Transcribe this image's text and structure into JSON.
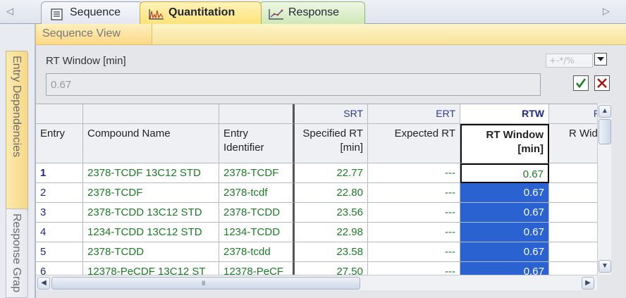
{
  "nav": {
    "scroll_left": "◁",
    "scroll_right": "▷"
  },
  "tabs": [
    {
      "label": "Sequence",
      "icon": "document-list-icon"
    },
    {
      "label": "Quantitation",
      "icon": "chromatogram-icon",
      "active": true
    },
    {
      "label": "Response",
      "icon": "response-graph-icon"
    }
  ],
  "subtab": {
    "label": "Sequence View"
  },
  "side_tabs": [
    {
      "label": "Entry Dependencies"
    },
    {
      "label": "Response Grap"
    }
  ],
  "editor": {
    "field_label": "RT Window [min]",
    "value": "0.67",
    "operators": "+-*/%",
    "confirm_icon": "checkmark-icon",
    "cancel_icon": "cross-icon"
  },
  "grid": {
    "group_headers": [
      "",
      "",
      "",
      "SRT",
      "ERT",
      "RTW",
      "R"
    ],
    "columns": [
      "Entry",
      "Compound Name",
      "Entry Identifier",
      "Specified RT [min]",
      "Expected RT",
      "RT Window [min]",
      "R Widt"
    ],
    "rows": [
      {
        "entry": "1",
        "name": "2378-TCDF 13C12 STD",
        "ident": "2378-TCDF",
        "srt": "22.77",
        "ert": "---",
        "rtw": "0.67"
      },
      {
        "entry": "2",
        "name": "2378-TCDF",
        "ident": "2378-tcdf",
        "srt": "22.80",
        "ert": "---",
        "rtw": "0.67"
      },
      {
        "entry": "3",
        "name": "2378-TCDD 13C12 STD",
        "ident": "2378-TCDD",
        "srt": "23.56",
        "ert": "---",
        "rtw": "0.67"
      },
      {
        "entry": "4",
        "name": "1234-TCDD 13C12 STD",
        "ident": "1234-TCDD",
        "srt": "22.98",
        "ert": "---",
        "rtw": "0.67"
      },
      {
        "entry": "5",
        "name": "2378-TCDD",
        "ident": "2378-tcdd",
        "srt": "23.58",
        "ert": "---",
        "rtw": "0.67"
      },
      {
        "entry": "6",
        "name": "12378-PeCDF 13C12 ST",
        "ident": "12378-PeCF",
        "srt": "27.50",
        "ert": "---",
        "rtw": "0.67"
      }
    ]
  },
  "scrollbar": {
    "grip": "III",
    "up": "▲",
    "down": "▼",
    "left": "◀",
    "right": "▶"
  }
}
